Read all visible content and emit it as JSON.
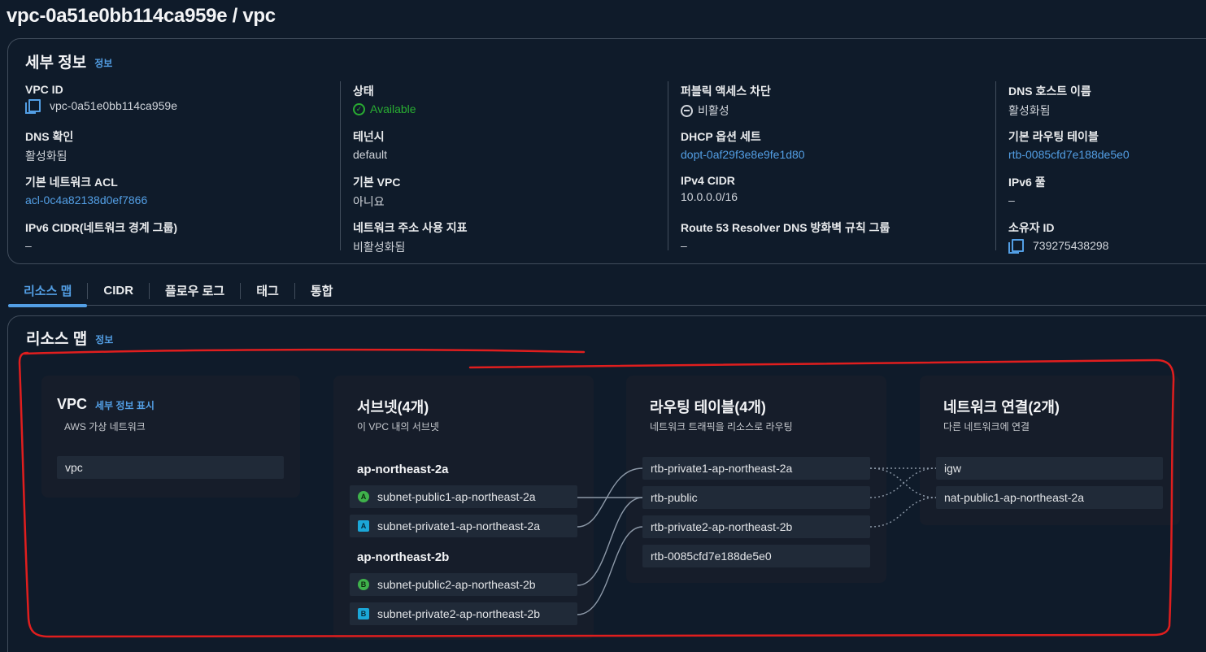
{
  "page": {
    "title": "vpc-0a51e0bb114ca959e / vpc"
  },
  "details": {
    "title": "세부 정보",
    "info_link": "정보",
    "fields": {
      "vpc_id": {
        "label": "VPC ID",
        "value": "vpc-0a51e0bb114ca959e"
      },
      "state": {
        "label": "상태",
        "value": "Available"
      },
      "block_public_access": {
        "label": "퍼블릭 액세스 차단",
        "value": "비활성"
      },
      "dns_hostnames": {
        "label": "DNS 호스트 이름",
        "value": "활성화됨"
      },
      "dns_resolution": {
        "label": "DNS 확인",
        "value": "활성화됨"
      },
      "tenancy": {
        "label": "테넌시",
        "value": "default"
      },
      "dhcp_option_set": {
        "label": "DHCP 옵션 세트",
        "value": "dopt-0af29f3e8e9fe1d80"
      },
      "main_route_table": {
        "label": "기본 라우팅 테이블",
        "value": "rtb-0085cfd7e188de5e0"
      },
      "main_network_acl": {
        "label": "기본 네트워크 ACL",
        "value": "acl-0c4a82138d0ef7866"
      },
      "default_vpc": {
        "label": "기본 VPC",
        "value": "아니요"
      },
      "ipv4_cidr": {
        "label": "IPv4 CIDR",
        "value": "10.0.0.0/16"
      },
      "ipv6_pool": {
        "label": "IPv6 풀",
        "value": "–"
      },
      "ipv6_cidr": {
        "label": "IPv6 CIDR(네트워크 경계 그룹)",
        "value": "–"
      },
      "network_address_usage": {
        "label": "네트워크 주소 사용 지표",
        "value": "비활성화됨"
      },
      "route53_firewall": {
        "label": "Route 53 Resolver DNS 방화벽 규칙 그룹",
        "value": "–"
      },
      "owner_id": {
        "label": "소유자 ID",
        "value": "739275438298"
      }
    }
  },
  "tabs": [
    "리소스 맵",
    "CIDR",
    "플로우 로그",
    "태그",
    "통합"
  ],
  "resource_map": {
    "title": "리소스 맵",
    "info_link": "정보",
    "vpc": {
      "title": "VPC",
      "link": "세부 정보 표시",
      "subtitle": "AWS 가상 네트워크",
      "node": "vpc"
    },
    "subnets": {
      "title": "서브넷(4개)",
      "subtitle": "이 VPC 내의 서브넷",
      "az1": "ap-northeast-2a",
      "az2": "ap-northeast-2b",
      "items": [
        {
          "badge": "A",
          "name": "subnet-public1-ap-northeast-2a"
        },
        {
          "badge": "A",
          "name": "subnet-private1-ap-northeast-2a"
        },
        {
          "badge": "B",
          "name": "subnet-public2-ap-northeast-2b"
        },
        {
          "badge": "B",
          "name": "subnet-private2-ap-northeast-2b"
        }
      ]
    },
    "route_tables": {
      "title": "라우팅 테이블(4개)",
      "subtitle": "네트워크 트래픽을 리소스로 라우팅",
      "items": [
        "rtb-private1-ap-northeast-2a",
        "rtb-public",
        "rtb-private2-ap-northeast-2b",
        "rtb-0085cfd7e188de5e0"
      ]
    },
    "connections": {
      "title": "네트워크 연결(2개)",
      "subtitle": "다른 네트워크에 연결",
      "items": [
        "igw",
        "nat-public1-ap-northeast-2a"
      ]
    }
  },
  "colors": {
    "link": "#539fe5",
    "success": "#29ad32",
    "annotation": "#e01e1e"
  }
}
